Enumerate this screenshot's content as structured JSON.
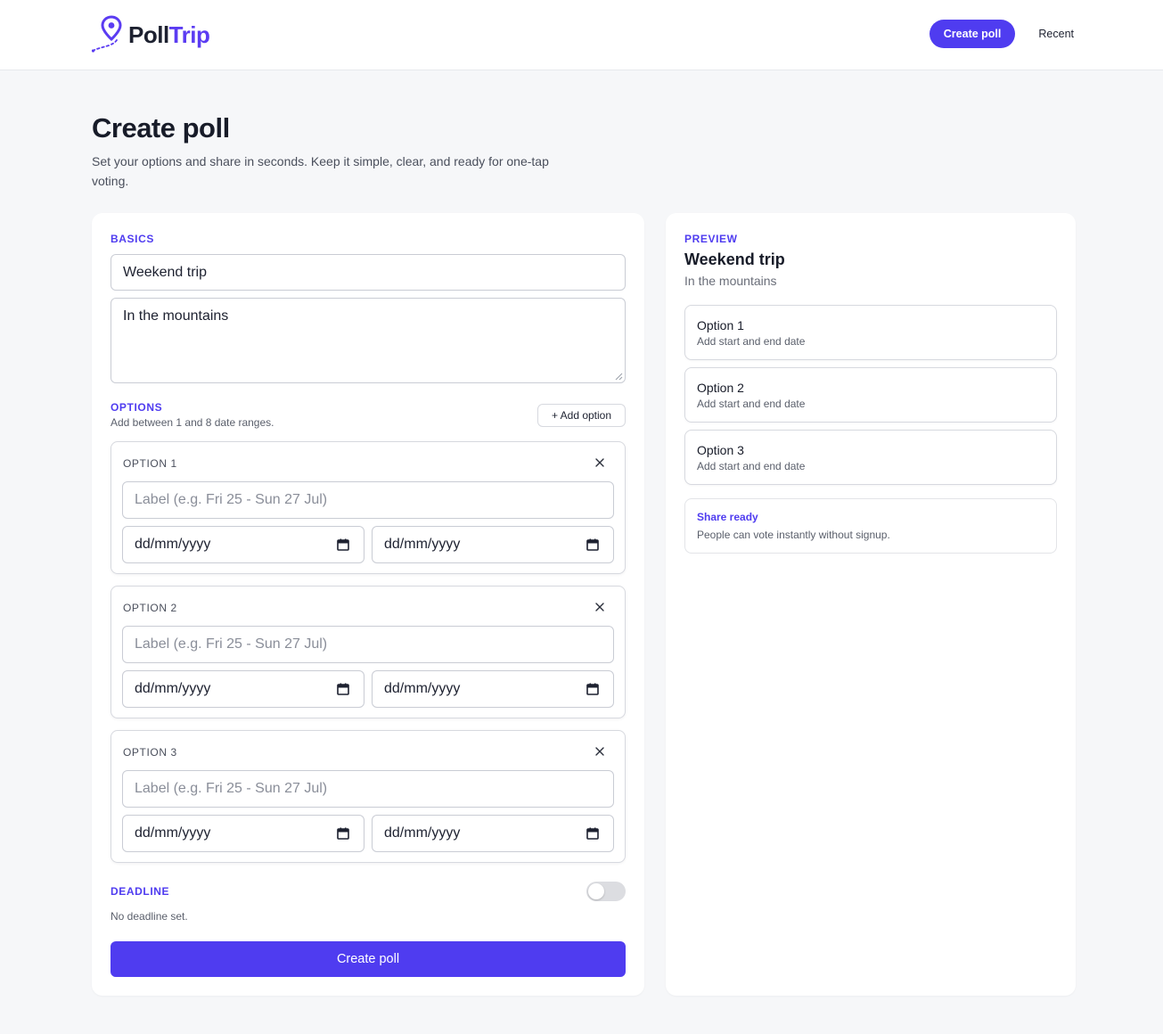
{
  "header": {
    "logo_poll": "Poll",
    "logo_trip": "Trip",
    "create_label": "Create poll",
    "recent_label": "Recent"
  },
  "page": {
    "title": "Create poll",
    "subtitle": "Set your options and share in seconds. Keep it simple, clear, and ready for one-tap voting."
  },
  "basics": {
    "section_label": "BASICS",
    "title_value": "Weekend trip",
    "description_value": "In the mountains"
  },
  "options": {
    "section_label": "OPTIONS",
    "hint": "Add between 1 and 8 date ranges.",
    "add_label": "+ Add option",
    "items": [
      {
        "title": "OPTION 1",
        "label_placeholder": "Label (e.g. Fri 25 - Sun 27 Jul)",
        "start_placeholder": "dd/mm/yyyy",
        "end_placeholder": "dd/mm/yyyy"
      },
      {
        "title": "OPTION 2",
        "label_placeholder": "Label (e.g. Fri 25 - Sun 27 Jul)",
        "start_placeholder": "dd/mm/yyyy",
        "end_placeholder": "dd/mm/yyyy"
      },
      {
        "title": "OPTION 3",
        "label_placeholder": "Label (e.g. Fri 25 - Sun 27 Jul)",
        "start_placeholder": "dd/mm/yyyy",
        "end_placeholder": "dd/mm/yyyy"
      }
    ]
  },
  "deadline": {
    "section_label": "DEADLINE",
    "status": "No deadline set.",
    "enabled": false
  },
  "submit_label": "Create poll",
  "preview": {
    "section_label": "PREVIEW",
    "title": "Weekend trip",
    "subtitle": "In the mountains",
    "options": [
      {
        "label": "Option 1",
        "hint": "Add start and end date"
      },
      {
        "label": "Option 2",
        "hint": "Add start and end date"
      },
      {
        "label": "Option 3",
        "hint": "Add start and end date"
      }
    ],
    "share_title": "Share ready",
    "share_text": "People can vote instantly without signup."
  },
  "colors": {
    "accent": "#4f3cf0",
    "background": "#f6f7f9",
    "text": "#1d2130"
  },
  "icons": {
    "logo": "map-pin-route-icon",
    "option_close": "close-icon",
    "date_picker": "calendar-icon"
  }
}
